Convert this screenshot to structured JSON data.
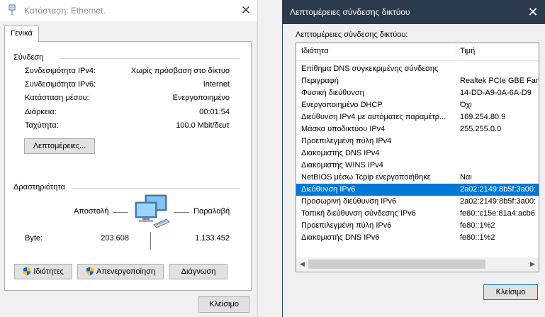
{
  "status_window": {
    "title": "Κατάσταση: Ethernet.",
    "tab": "Γενικά",
    "connection": {
      "header": "Σύνδεση",
      "rows": [
        {
          "label": "Συνδεσιμότητα IPv4:",
          "value": "Χωρίς πρόσβαση στο δίκτυο"
        },
        {
          "label": "Συνδεσιμότητα IPv6:",
          "value": "Internet"
        },
        {
          "label": "Κατάσταση μέσου:",
          "value": "Ενεργοποιημένο"
        },
        {
          "label": "Διάρκεια:",
          "value": "00:01:54"
        },
        {
          "label": "Ταχύτητα:",
          "value": "100.0 Mbit/δευτ"
        }
      ],
      "details_button": "Λεπτομέρειες..."
    },
    "activity": {
      "header": "Δραστηριότητα",
      "sent_label": "Αποστολή",
      "received_label": "Παραλαβή",
      "bytes_label": "Byte:",
      "bytes_sent": "203.608",
      "bytes_received": "1.133.452"
    },
    "buttons": {
      "properties": "Ιδιότητες",
      "disable": "Απενεργοποίηση",
      "diagnose": "Διάγνωση"
    },
    "close_button": "Κλείσιμο"
  },
  "details_window": {
    "title": "Λεπτομέρειες σύνδεσης δικτύου",
    "subtitle": "Λεπτομέρειες σύνδεσης δικτύου:",
    "columns": {
      "property": "Ιδιότητα",
      "value": "Τιμή"
    },
    "rows": [
      {
        "property": "Επίθημα DNS συγκεκριμένης σύνδεσης",
        "value": ""
      },
      {
        "property": "Περιγραφή",
        "value": "Realtek PCIe GBE Fam"
      },
      {
        "property": "Φυσική διεύθυνση",
        "value": "14-DD-A9-0A-6A-D9"
      },
      {
        "property": "Ενεργοποιημένο DHCP",
        "value": "Όχι"
      },
      {
        "property": "Διεύθυνση IPv4 με αυτόματες παραμέτρ...",
        "value": "169.254.80.9"
      },
      {
        "property": "Μάσκα υποδικτύου IPv4",
        "value": "255.255.0.0"
      },
      {
        "property": "Προεπιλεγμένη πύλη IPv4",
        "value": ""
      },
      {
        "property": "Διακομιστής DNS IPv4",
        "value": ""
      },
      {
        "property": "Διακομιστής WINS IPv4",
        "value": ""
      },
      {
        "property": "NetBIOS μέσω Tcpip ενεργοποιήθηκε",
        "value": "Ναι"
      },
      {
        "property": "Διεύθυνση IPv6",
        "value": "2a02:2149:8b5f:3a00:"
      },
      {
        "property": "Προσωρινή διεύθυνση IPv6",
        "value": "2a02:2149:8b5f:3a00:"
      },
      {
        "property": "Τοπική διεύθυνση σύνδεσης IPv6",
        "value": "fe80::c15e:81a4:acb6"
      },
      {
        "property": "Προεπιλεγμένη πύλη IPv6",
        "value": "fe80::1%2"
      },
      {
        "property": "Διακομιστής DNS IPv6",
        "value": "fe80::1%2"
      }
    ],
    "selected_row_index": 10,
    "close_button": "Κλείσιμο"
  },
  "colors": {
    "selection": "#0078d7",
    "dark_titlebar": "#2b3a4d",
    "shield_blue": "#1f5fbf",
    "shield_yellow": "#f2c12e"
  }
}
